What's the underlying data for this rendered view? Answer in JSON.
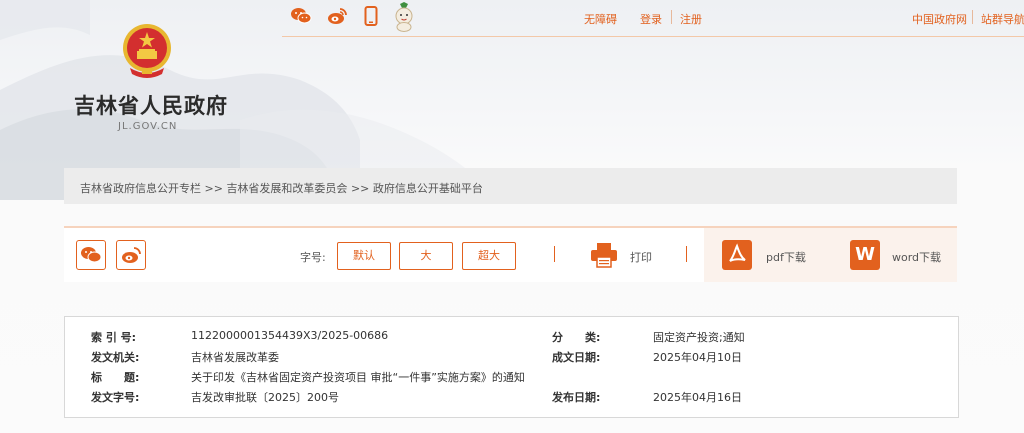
{
  "colors": {
    "accent": "#e2611e",
    "accent_light": "#fbf2ec",
    "border": "#d8d8d8"
  },
  "top_icons": [
    "wechat-icon",
    "weibo-icon",
    "mobile-icon",
    "mascot-icon"
  ],
  "top_links": {
    "accessibility": "无障碍",
    "login": "登录",
    "register": "注册",
    "gov_site": "中国政府网",
    "site_nav": "站群导航"
  },
  "site": {
    "title": "吉林省人民政府",
    "domain": "JL.GOV.CN"
  },
  "breadcrumb": {
    "items": [
      "吉林省政府信息公开专栏",
      "吉林省发展和改革委员会",
      "政府信息公开基础平台"
    ],
    "separator": ">>"
  },
  "toolbar": {
    "font_label": "字号:",
    "font_sizes": [
      "默认",
      "大",
      "超大"
    ],
    "print_label": "打印",
    "pdf_label": "pdf下载",
    "word_label": "word下载",
    "word_letter": "W"
  },
  "info": {
    "index_label": "索 引 号:",
    "index_value": "1122000001354439X3/2025-00686",
    "category_label": "分　　类:",
    "category_value": "固定资产投资;通知",
    "issuer_label": "发文机关:",
    "issuer_value": "吉林省发展改革委",
    "created_label": "成文日期:",
    "created_value": "2025年04月10日",
    "title_label": "标　　题:",
    "title_value": "关于印发《吉林省固定资产投资项目 审批“一件事”实施方案》的通知",
    "docno_label": "发文字号:",
    "docno_value": "吉发改审批联〔2025〕200号",
    "published_label": "发布日期:",
    "published_value": "2025年04月16日"
  }
}
